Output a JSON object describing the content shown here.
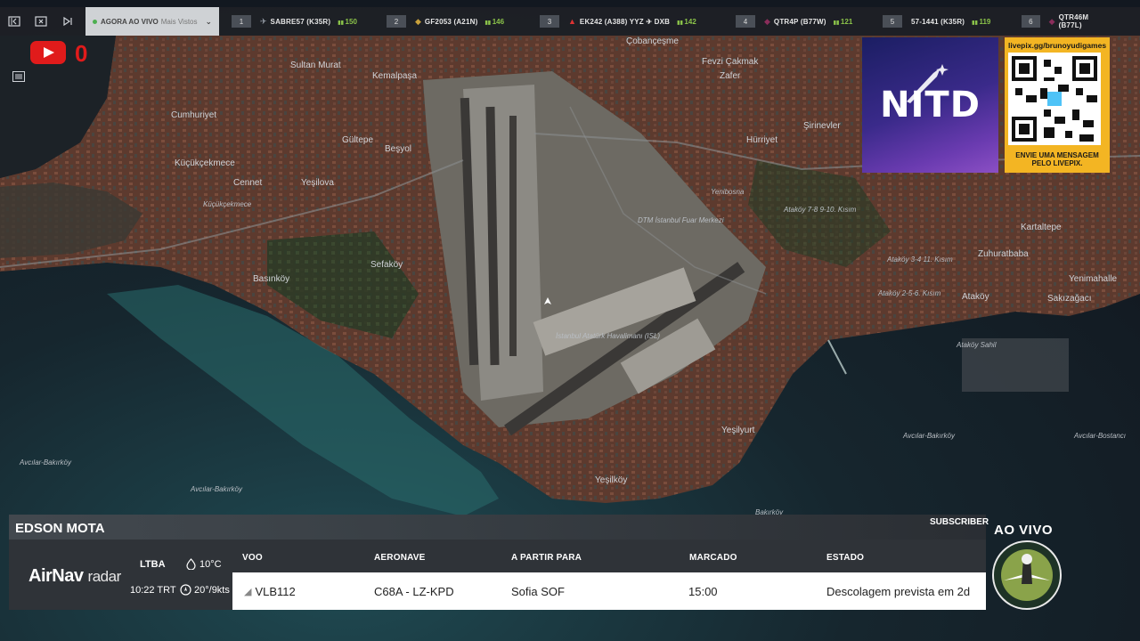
{
  "topbar": {
    "mode_live": "AGORA AO VIVO",
    "mode_sub": "Mais Vistos",
    "ticker": [
      {
        "rank": "1",
        "flight": "SABRE57 (K35R)",
        "count": "150"
      },
      {
        "rank": "2",
        "flight": "GF2053 (A21N)",
        "count": "146"
      },
      {
        "rank": "3",
        "flight": "EK242 (A388)  YYZ ✈ DXB",
        "count": "142"
      },
      {
        "rank": "4",
        "flight": "QTR4P (B77W)",
        "count": "121"
      },
      {
        "rank": "5",
        "flight": "57-1441 (K35R)",
        "count": "119"
      },
      {
        "rank": "6",
        "flight": "QTR46M (B77L)",
        "count": ""
      }
    ]
  },
  "youtube": {
    "count": "0"
  },
  "map_labels": {
    "l1": "Sultan Murat",
    "l2": "Kemalpaşa",
    "l3": "Cumhuriyet",
    "l4": "Gültepe",
    "l5": "Beşyol",
    "l6": "Küçükçekmece",
    "l7": "Cennet",
    "l8": "Yeşilova",
    "l9": "Küçükçekmece",
    "l10": "Sefaköy",
    "l11": "Basınköy",
    "l12": "Fevzi Çakmak",
    "l13": "Hürriyet",
    "l14": "Şirinevler",
    "l15": "Çobançeşme",
    "l16": "Zafer",
    "l17": "Ataköy 7-8 9-10. Kısım",
    "l18": "Ataköy 3-4 11. Kısım",
    "l19": "Ataköy 2-5-6. Kısım",
    "l20": "Zuhuratbaba",
    "l21": "Kartaltepe",
    "l22": "Yenimahalle",
    "l23": "Sakızağacı",
    "l24": "Ataköy",
    "l25": "Yeşilyurt",
    "l26": "Yeşilköy",
    "l27": "Avcılar-Bakırköy",
    "l28": "Avcılar-Bakırköy",
    "l29": "Avcılar-Bakırköy",
    "l30": "Avcılar-Bostancı",
    "l31": "Bakırköy",
    "l32": "İstanbul Atatürk Havalimanı (ISL)",
    "l33": "DTM İstanbul Fuar Merkezi",
    "l34": "Yenibosna",
    "l35": "Kartaltepe",
    "l36": "Ataköy Sahil",
    "l37": "Avcılar-Bakırköy"
  },
  "promo": {
    "logo_text": "NITD",
    "qr_url": "livepix.gg/brunoyudigames",
    "qr_cta": "ENVIE UMA MENSAGEM PELO LIVEPIX."
  },
  "panel": {
    "streamer": "EDSON MOTA",
    "subscriber_label": "SUBSCRIBER",
    "live_label": "AO VIVO",
    "brand_bold": "AirNav",
    "brand_light": "radar",
    "airport_code": "LTBA",
    "local_time": "10:22 TRT",
    "temperature": "10°C",
    "wind": "20°/9kts",
    "columns": {
      "flight": "VOO",
      "aircraft": "AERONAVE",
      "route": "A PARTIR PARA",
      "scheduled": "MARCADO",
      "status": "ESTADO"
    },
    "row": {
      "flight": "VLB112",
      "aircraft": "C68A - LZ-KPD",
      "route": "Sofia SOF",
      "scheduled": "15:00",
      "status": "Descolagem prevista em 2d"
    }
  }
}
